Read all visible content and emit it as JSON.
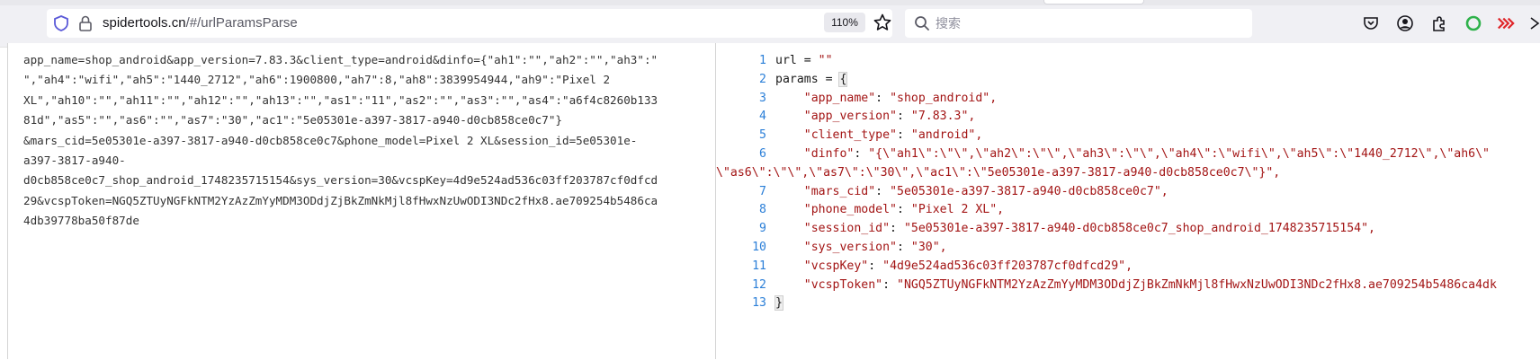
{
  "browser": {
    "url_host": "spidertools.cn",
    "url_path": "/#/urlParamsParse",
    "zoom": "110%",
    "search_placeholder": "搜索"
  },
  "input": {
    "lines": [
      "app_name=shop_android&app_version=7.83.3&client_type=android&dinfo={\"ah1\":\"\",\"ah2\":\"\",\"ah3\":\"",
      "\",\"ah4\":\"wifi\",\"ah5\":\"1440_2712\",\"ah6\":1900800,\"ah7\":8,\"ah8\":3839954944,\"ah9\":\"Pixel 2",
      "XL\",\"ah10\":\"\",\"ah11\":\"\",\"ah12\":\"\",\"ah13\":\"\",\"as1\":\"11\",\"as2\":\"\",\"as3\":\"\",\"as4\":\"a6f4c8260b133",
      "81d\",\"as5\":\"\",\"as6\":\"\",\"as7\":\"30\",\"ac1\":\"5e05301e-a397-3817-a940-d0cb858ce0c7\"}",
      "&mars_cid=5e05301e-a397-3817-a940-d0cb858ce0c7&phone_model=Pixel 2 XL&session_id=5e05301e-",
      "a397-3817-a940-",
      "d0cb858ce0c7_shop_android_1748235715154&sys_version=30&vcspKey=4d9e524ad536c03ff203787cf0dfcd",
      "29&vcspToken=NGQ5ZTUyNGFkNTM2YzAzZmYyMDM3ODdjZjBkZmNkMjl8fHwxNzUwODI3NDc2fHx8.ae709254b5486ca",
      "4db39778ba50f87de"
    ]
  },
  "output": {
    "url_var": "url",
    "url_value": "\"\"",
    "params_var": "params",
    "line_numbers": [
      "1",
      "2",
      "3",
      "4",
      "5",
      "6",
      "7",
      "8",
      "9",
      "10",
      "11",
      "12",
      "13"
    ],
    "entries": [
      {
        "key": "\"app_name\"",
        "value": "\"shop_android\","
      },
      {
        "key": "\"app_version\"",
        "value": "\"7.83.3\","
      },
      {
        "key": "\"client_type\"",
        "value": "\"android\","
      },
      {
        "key": "\"dinfo\"",
        "value": "\"{\\\"ah1\\\":\\\"\\\",\\\"ah2\\\":\\\"\\\",\\\"ah3\\\":\\\"\\\",\\\"ah4\\\":\\\"wifi\\\",\\\"ah5\\\":\\\"1440_2712\\\",\\\"ah6\\\""
      },
      {
        "key": "\"mars_cid\"",
        "value": "\"5e05301e-a397-3817-a940-d0cb858ce0c7\","
      },
      {
        "key": "\"phone_model\"",
        "value": "\"Pixel 2 XL\","
      },
      {
        "key": "\"session_id\"",
        "value": "\"5e05301e-a397-3817-a940-d0cb858ce0c7_shop_android_1748235715154\","
      },
      {
        "key": "\"sys_version\"",
        "value": "\"30\","
      },
      {
        "key": "\"vcspKey\"",
        "value": "\"4d9e524ad536c03ff203787cf0dfcd29\","
      },
      {
        "key": "\"vcspToken\"",
        "value": "\"NGQ5ZTUyNGFkNTM2YzAzZmYyMDM3ODdjZjBkZmNkMjl8fHwxNzUwODI3NDc2fHx8.ae709254b5486ca4dk"
      }
    ],
    "dinfo_continuation": "\\\"as6\\\":\\\"\\\",\\\"as7\\\":\\\"30\\\",\\\"ac1\\\":\\\"5e05301e-a397-3817-a940-d0cb858ce0c7\\\"}\","
  }
}
